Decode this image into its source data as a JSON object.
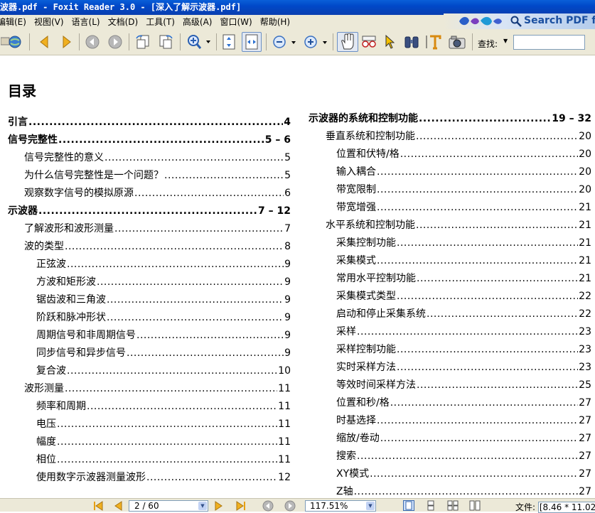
{
  "window": {
    "title": "波器.pdf - Foxit Reader 3.0 - [深入了解示波器.pdf]"
  },
  "menu": [
    "编辑(E)",
    "视图(V)",
    "语言(L)",
    "文档(D)",
    "工具(T)",
    "高级(A)",
    "窗口(W)",
    "帮助(H)"
  ],
  "banner": {
    "search_text": "Search PDF f"
  },
  "toolbar": {
    "find_label": "查找:",
    "find_value": ""
  },
  "document": {
    "heading": "目录",
    "toc_left": [
      {
        "label": "引言",
        "page": "4",
        "level": 0,
        "bold": true
      },
      {
        "label": "信号完整性",
        "page": "5 – 6",
        "level": 0,
        "bold": true
      },
      {
        "label": "信号完整性的意义",
        "page": "5",
        "level": 1,
        "bold": false
      },
      {
        "label": "为什么信号完整性是一个问题？",
        "page": "5",
        "level": 1,
        "bold": false
      },
      {
        "label": "观察数字信号的模拟原源",
        "page": "6",
        "level": 1,
        "bold": false
      },
      {
        "label": "示波器",
        "page": "7 – 12",
        "level": 0,
        "bold": true
      },
      {
        "label": "了解波形和波形测量",
        "page": "7",
        "level": 1,
        "bold": false
      },
      {
        "label": "波的类型",
        "page": "8",
        "level": 1,
        "bold": false
      },
      {
        "label": "正弦波",
        "page": "9",
        "level": 2,
        "bold": false
      },
      {
        "label": "方波和矩形波",
        "page": "9",
        "level": 2,
        "bold": false
      },
      {
        "label": "锯齿波和三角波",
        "page": "9",
        "level": 2,
        "bold": false
      },
      {
        "label": "阶跃和脉冲形状",
        "page": "9",
        "level": 2,
        "bold": false
      },
      {
        "label": "周期信号和非周期信号",
        "page": "9",
        "level": 2,
        "bold": false
      },
      {
        "label": "同步信号和异步信号",
        "page": "9",
        "level": 2,
        "bold": false
      },
      {
        "label": "复合波",
        "page": "10",
        "level": 2,
        "bold": false
      },
      {
        "label": "波形测量",
        "page": "11",
        "level": 1,
        "bold": false
      },
      {
        "label": "频率和周期",
        "page": "11",
        "level": 2,
        "bold": false
      },
      {
        "label": "电压",
        "page": "11",
        "level": 2,
        "bold": false
      },
      {
        "label": "幅度",
        "page": "11",
        "level": 2,
        "bold": false
      },
      {
        "label": "相位",
        "page": "11",
        "level": 2,
        "bold": false
      },
      {
        "label": "使用数字示波器测量波形",
        "page": "12",
        "level": 2,
        "bold": false
      }
    ],
    "toc_right": [
      {
        "label": "示波器的系统和控制功能",
        "page": "19 – 32",
        "level": 0,
        "bold": true
      },
      {
        "label": "垂直系统和控制功能",
        "page": "20",
        "level": 1,
        "bold": false
      },
      {
        "label": "位置和伏特/格",
        "page": "20",
        "level": 2,
        "bold": false
      },
      {
        "label": "输入耦合",
        "page": "20",
        "level": 2,
        "bold": false
      },
      {
        "label": "带宽限制",
        "page": "20",
        "level": 2,
        "bold": false
      },
      {
        "label": "带宽增强",
        "page": "21",
        "level": 2,
        "bold": false
      },
      {
        "label": "水平系统和控制功能",
        "page": "21",
        "level": 1,
        "bold": false
      },
      {
        "label": "采集控制功能",
        "page": "21",
        "level": 2,
        "bold": false
      },
      {
        "label": "采集模式",
        "page": "21",
        "level": 2,
        "bold": false
      },
      {
        "label": "常用水平控制功能",
        "page": "21",
        "level": 2,
        "bold": false
      },
      {
        "label": "采集模式类型",
        "page": "22",
        "level": 2,
        "bold": false
      },
      {
        "label": "启动和停止采集系统",
        "page": "22",
        "level": 2,
        "bold": false
      },
      {
        "label": "采样",
        "page": "23",
        "level": 2,
        "bold": false
      },
      {
        "label": "采样控制功能",
        "page": "23",
        "level": 2,
        "bold": false
      },
      {
        "label": "实时采样方法",
        "page": "23",
        "level": 2,
        "bold": false
      },
      {
        "label": "等效时间采样方法",
        "page": "25",
        "level": 2,
        "bold": false
      },
      {
        "label": "位置和秒/格",
        "page": "27",
        "level": 2,
        "bold": false
      },
      {
        "label": "时基选择",
        "page": "27",
        "level": 2,
        "bold": false
      },
      {
        "label": "缩放/卷动",
        "page": "27",
        "level": 2,
        "bold": false
      },
      {
        "label": "搜索",
        "page": "27",
        "level": 2,
        "bold": false
      },
      {
        "label": "XY模式",
        "page": "27",
        "level": 2,
        "bold": false
      },
      {
        "label": "Z轴",
        "page": "27",
        "level": 2,
        "bold": false
      }
    ]
  },
  "status": {
    "page_indicator": "2 / 60",
    "zoom": "117.51%",
    "file_label": "文件:",
    "file_size": "[8.46 * 11.02"
  }
}
